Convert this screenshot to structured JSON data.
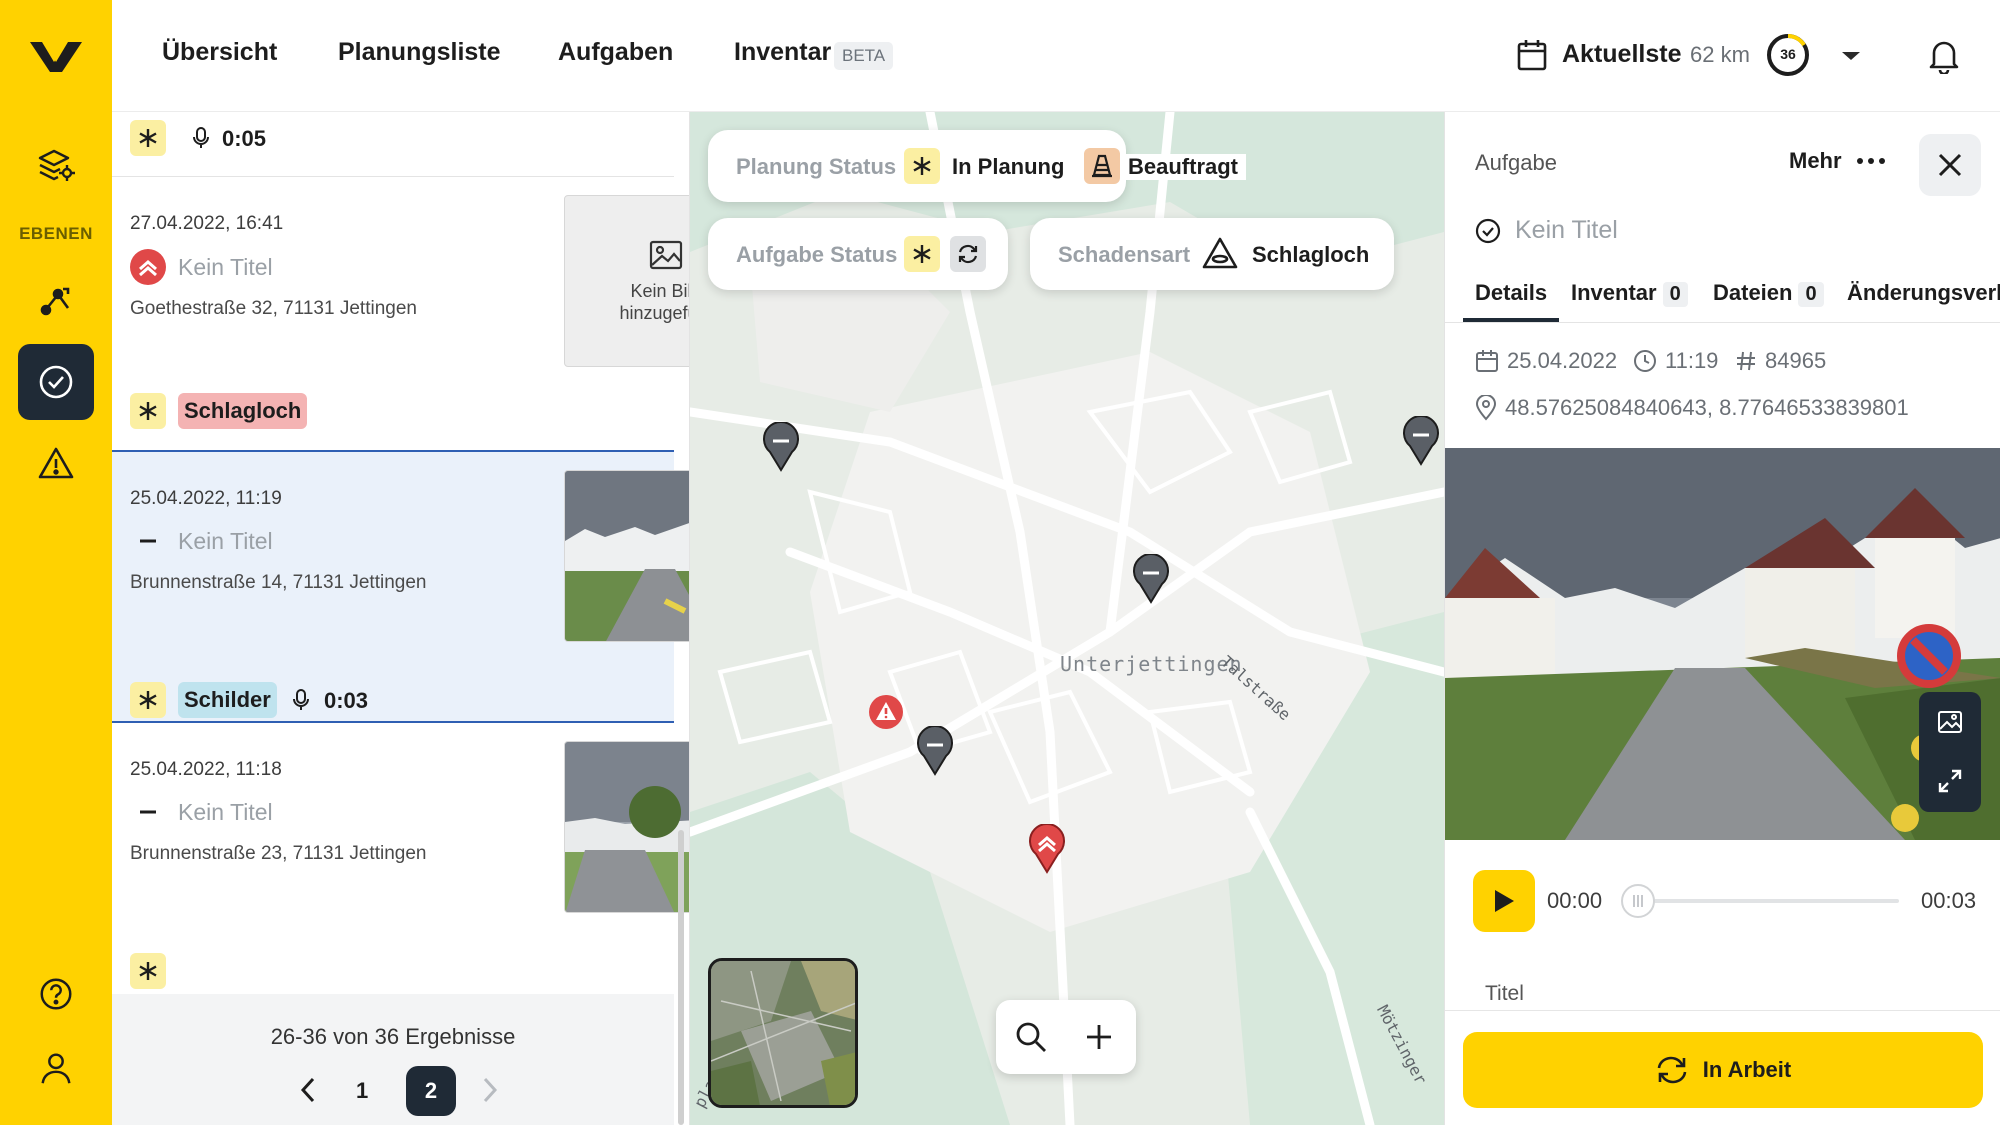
{
  "nav": {
    "items": [
      "Übersicht",
      "Planungsliste",
      "Aufgaben",
      "Inventar"
    ],
    "beta_badge": "BETA",
    "date_label": "Aktuellste",
    "distance": "62 km",
    "progress_count": "36"
  },
  "rail": {
    "layers_label": "EBENEN"
  },
  "list": {
    "top_item": {
      "audio_duration": "0:05"
    },
    "items": [
      {
        "date": "27.04.2022, 16:41",
        "title": "Kein Titel",
        "address": "Goethestraße 32, 71131 Jettingen",
        "no_image_text": "Kein Bild hinzugefügt",
        "tag": "Schlagloch",
        "priority": "high"
      },
      {
        "date": "25.04.2022, 11:19",
        "title": "Kein Titel",
        "address": "Brunnenstraße 14, 71131 Jettingen",
        "tag": "Schilder",
        "audio_duration": "0:03",
        "priority": "normal",
        "selected": true
      },
      {
        "date": "25.04.2022, 11:18",
        "title": "Kein Titel",
        "address": "Brunnenstraße 23, 71131 Jettingen",
        "priority": "normal"
      }
    ],
    "pagination": {
      "summary": "26-36 von 36 Ergebnisse",
      "pages": [
        "1",
        "2"
      ],
      "current": "2"
    }
  },
  "map": {
    "filters": {
      "planning_status_label": "Planung Status",
      "planning_status_values": [
        "In Planung",
        "Beauftragt"
      ],
      "task_status_label": "Aufgabe Status",
      "damage_type_label": "Schadensart",
      "damage_type_value": "Schlagloch"
    },
    "place_label": "Unterjettingen",
    "street_labels": [
      "Talstraße",
      "Mötzinger",
      "pla"
    ]
  },
  "detail": {
    "header": "Aufgabe",
    "more_label": "Mehr",
    "title": "Kein Titel",
    "tabs": [
      {
        "label": "Details",
        "count": null
      },
      {
        "label": "Inventar",
        "count": "0"
      },
      {
        "label": "Dateien",
        "count": "0"
      },
      {
        "label": "Änderungsverla",
        "count": null
      }
    ],
    "date": "25.04.2022",
    "time": "11:19",
    "id": "84965",
    "coordinates": "48.57625084840643, 8.77646533839801",
    "audio": {
      "current": "00:00",
      "total": "00:03",
      "progress": 0
    },
    "title_field_label": "Titel",
    "action_label": "In Arbeit"
  },
  "colors": {
    "brand_yellow": "#ffd200",
    "dark": "#1f2a36",
    "high_priority_red": "#e04848",
    "tag_red": "#f4b3b3",
    "tag_blue": "#bfe3ee",
    "tag_yellow": "#fbefa2",
    "tag_orange": "#f3c9a4"
  }
}
